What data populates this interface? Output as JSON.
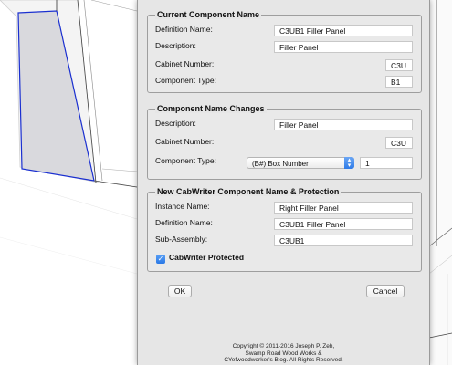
{
  "current": {
    "title": "Current Component Name",
    "definition_label": "Definition Name:",
    "definition_value": "C3UB1 Filler Panel",
    "description_label": "Description:",
    "description_value": "Filler Panel",
    "cabinet_label": "Cabinet Number:",
    "cabinet_value": "C3U",
    "type_label": "Component Type:",
    "type_value": "B1"
  },
  "changes": {
    "title": "Component Name Changes",
    "description_label": "Description:",
    "description_value": "Filler Panel",
    "cabinet_label": "Cabinet Number:",
    "cabinet_value": "C3U",
    "type_label": "Component Type:",
    "type_select": "(B#) Box Number",
    "type_number": "1"
  },
  "newname": {
    "title": "New CabWriter Component Name & Protection",
    "instance_label": "Instance Name:",
    "instance_value": "Right Filler Panel",
    "definition_label": "Definition Name:",
    "definition_value": "C3UB1 Filler Panel",
    "subassembly_label": "Sub-Assembly:",
    "subassembly_value": "C3UB1",
    "protected_label": "CabWriter Protected",
    "protected_checked": true
  },
  "buttons": {
    "ok": "OK",
    "cancel": "Cancel"
  },
  "copyright": {
    "line1": "Copyright © 2011-2016 Joseph P. Zeh,",
    "line2": "Swamp Road Wood Works &",
    "line3": "CYefwoodworker's Blog. All Rights Reserved."
  },
  "colors": {
    "accent": "#2f7be8",
    "selected_edge": "#1a2fd0"
  }
}
